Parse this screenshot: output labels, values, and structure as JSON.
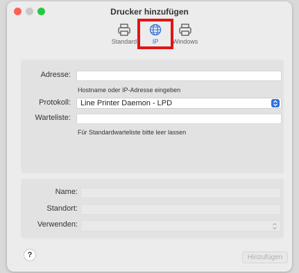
{
  "window": {
    "title": "Drucker hinzufügen"
  },
  "toolbar": {
    "items": [
      {
        "label": "Standard",
        "icon": "printer-icon"
      },
      {
        "label": "IP",
        "icon": "globe-icon"
      },
      {
        "label": "Windows",
        "icon": "printer-icon"
      }
    ],
    "selected": "IP",
    "highlight_color": "#e01515",
    "accent": "#2a6bd8"
  },
  "form": {
    "address_label": "Adresse:",
    "address_value": "",
    "address_hint": "Hostname oder IP-Adresse eingeben",
    "protocol_label": "Protokoll:",
    "protocol_value": "Line Printer Daemon - LPD",
    "queue_label": "Warteliste:",
    "queue_value": "",
    "queue_hint": "Für Standardwarteliste bitte leer lassen"
  },
  "details": {
    "name_label": "Name:",
    "location_label": "Standort:",
    "use_label": "Verwenden:"
  },
  "footer": {
    "help_label": "?",
    "add_label": "Hinzufügen"
  }
}
